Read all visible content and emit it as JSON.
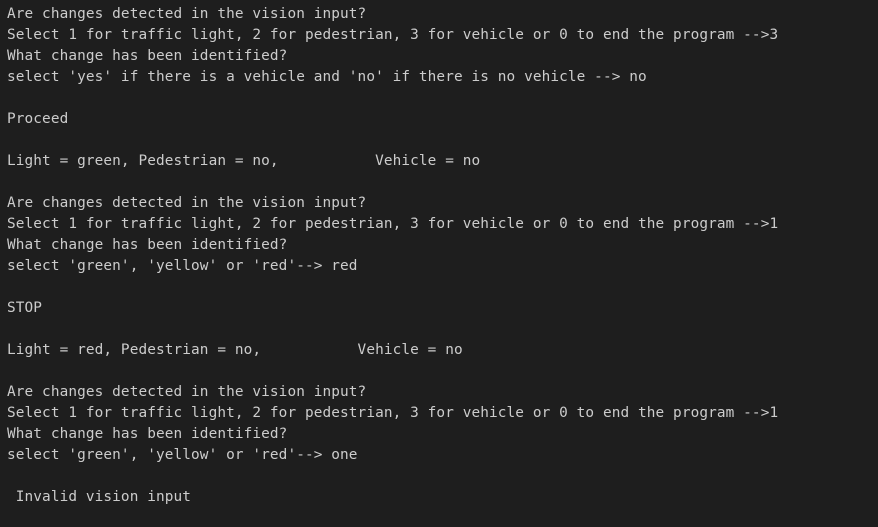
{
  "terminal": {
    "lines": [
      "Are changes detected in the vision input?",
      "Select 1 for traffic light, 2 for pedestrian, 3 for vehicle or 0 to end the program -->3",
      "What change has been identified?",
      "select 'yes' if there is a vehicle and 'no' if there is no vehicle --> no",
      "",
      "Proceed",
      "",
      "Light = green, Pedestrian = no,           Vehicle = no",
      "",
      "Are changes detected in the vision input?",
      "Select 1 for traffic light, 2 for pedestrian, 3 for vehicle or 0 to end the program -->1",
      "What change has been identified?",
      "select 'green', 'yellow' or 'red'--> red",
      "",
      "STOP",
      "",
      "Light = red, Pedestrian = no,           Vehicle = no",
      "",
      "Are changes detected in the vision input?",
      "Select 1 for traffic light, 2 for pedestrian, 3 for vehicle or 0 to end the program -->1",
      "What change has been identified?",
      "select 'green', 'yellow' or 'red'--> one",
      "",
      " Invalid vision input"
    ]
  }
}
